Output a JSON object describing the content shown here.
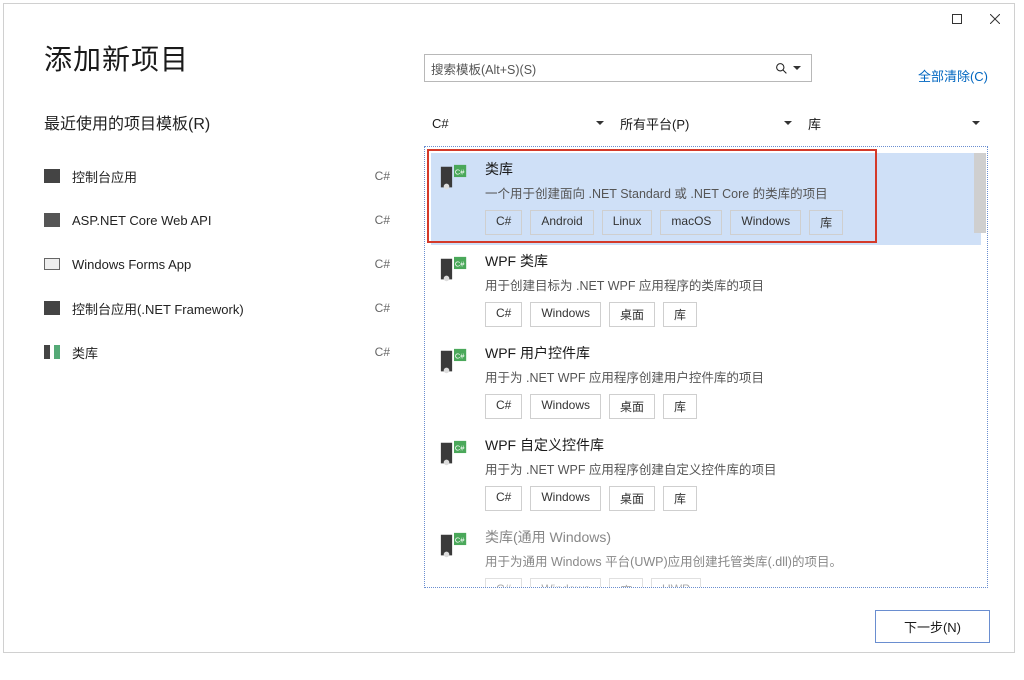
{
  "titlebar": {},
  "dialog": {
    "title": "添加新项目",
    "recent_section": "最近使用的项目模板(R)"
  },
  "recent": [
    {
      "label": "控制台应用",
      "lang": "C#",
      "icon": "console-icon"
    },
    {
      "label": "ASP.NET Core Web API",
      "lang": "C#",
      "icon": "webapi-icon"
    },
    {
      "label": "Windows Forms App",
      "lang": "C#",
      "icon": "winforms-icon"
    },
    {
      "label": "控制台应用(.NET Framework)",
      "lang": "C#",
      "icon": "console-icon"
    },
    {
      "label": "类库",
      "lang": "C#",
      "icon": "classlib-icon"
    }
  ],
  "search": {
    "placeholder": "搜索模板(Alt+S)(S)"
  },
  "clear_all": "全部清除(C)",
  "filters": {
    "language": "C#",
    "platform": "所有平台(P)",
    "type": "库"
  },
  "templates": [
    {
      "name": "类库",
      "desc": "一个用于创建面向 .NET Standard 或 .NET Core 的类库的项目",
      "tags": [
        "C#",
        "Android",
        "Linux",
        "macOS",
        "Windows",
        "库"
      ],
      "selected": true
    },
    {
      "name": "WPF 类库",
      "desc": "用于创建目标为 .NET WPF 应用程序的类库的项目",
      "tags": [
        "C#",
        "Windows",
        "桌面",
        "库"
      ]
    },
    {
      "name": "WPF 用户控件库",
      "desc": "用于为 .NET WPF 应用程序创建用户控件库的项目",
      "tags": [
        "C#",
        "Windows",
        "桌面",
        "库"
      ]
    },
    {
      "name": "WPF 自定义控件库",
      "desc": "用于为 .NET WPF 应用程序创建自定义控件库的项目",
      "tags": [
        "C#",
        "Windows",
        "桌面",
        "库"
      ]
    },
    {
      "name": "类库(通用 Windows)",
      "desc": "用于为通用 Windows 平台(UWP)应用创建托管类库(.dll)的项目。",
      "tags": [
        "C#",
        "Windows",
        "库",
        "UWP"
      ],
      "faded": true
    }
  ],
  "footer": {
    "next": "下一步(N)"
  }
}
